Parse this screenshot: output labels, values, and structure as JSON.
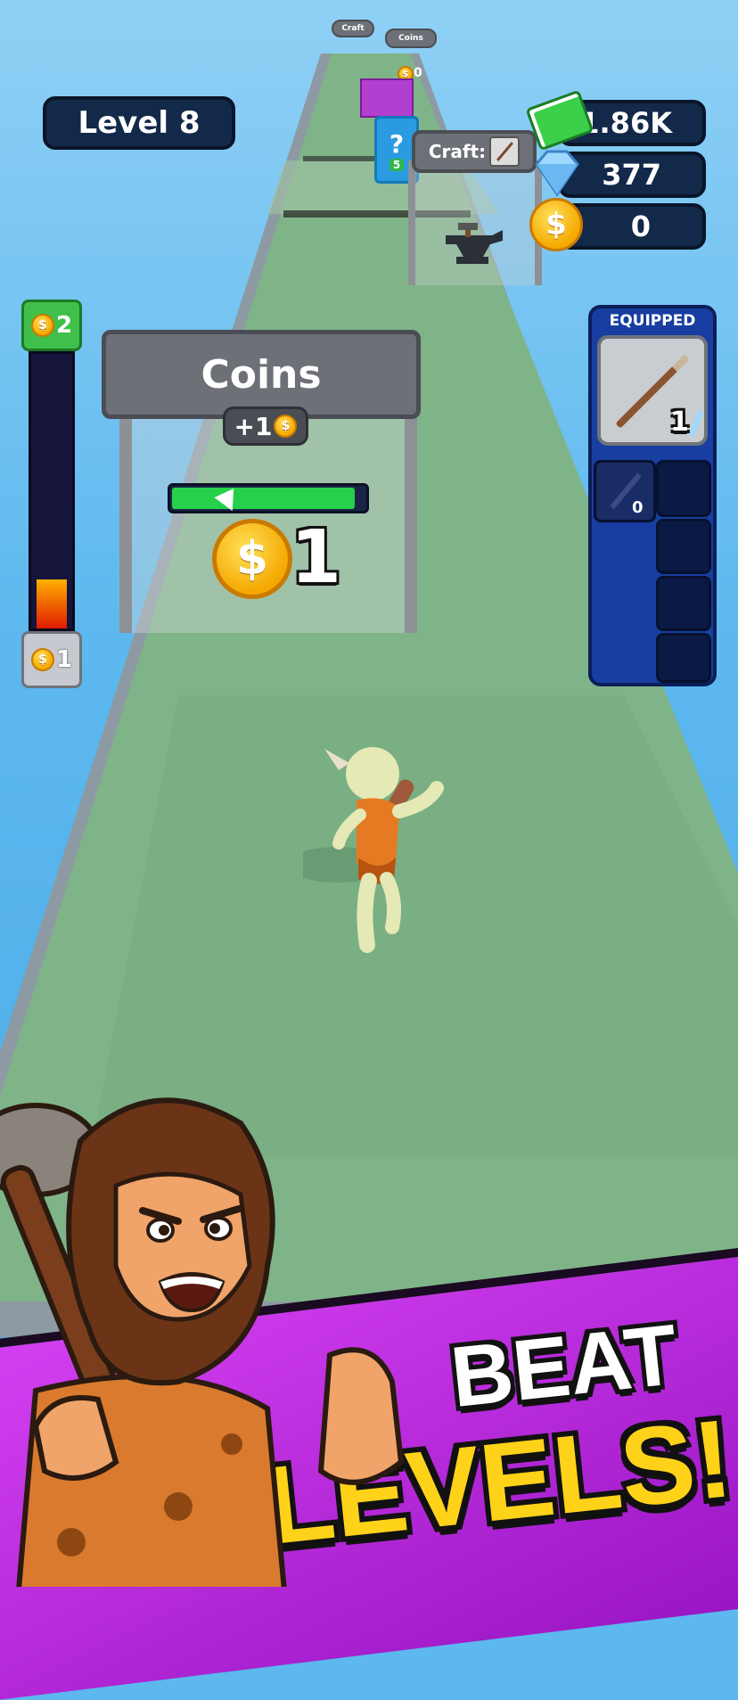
{
  "hud": {
    "level_label": "Level 8",
    "cash_value": "1.86K",
    "gems_value": "377",
    "coins_value": "0",
    "cash_icon": "cash-stack-icon",
    "gem_icon": "diamond-icon",
    "coin_icon": "coin-icon"
  },
  "progress_meter": {
    "top_label": "2",
    "bottom_label": "1",
    "fill_fraction": 0.18
  },
  "equipped": {
    "title": "EQUIPPED",
    "main_item_count": "1",
    "secondary_item_count": "0",
    "weapon_icon": "spear-icon",
    "secondary_icon": "sword-icon"
  },
  "coins_gate": {
    "title": "Coins",
    "bonus_label": "+1",
    "current_value": "1",
    "bar_fill_fraction": 0.95
  },
  "craft_gate": {
    "label": "Craft:"
  },
  "far_gates": {
    "coins_label": "Coins",
    "craft_label": "Craft",
    "mystery_value": "5",
    "coin_value": "0"
  },
  "promo": {
    "line1": "BEAT",
    "line2": "LEVELS!"
  },
  "colors": {
    "sky": "#5cb8ee",
    "track": "#7fb488",
    "hud_panel": "#13294a",
    "promo_banner": "#b81fd8",
    "promo_text": "#ffd21a"
  }
}
